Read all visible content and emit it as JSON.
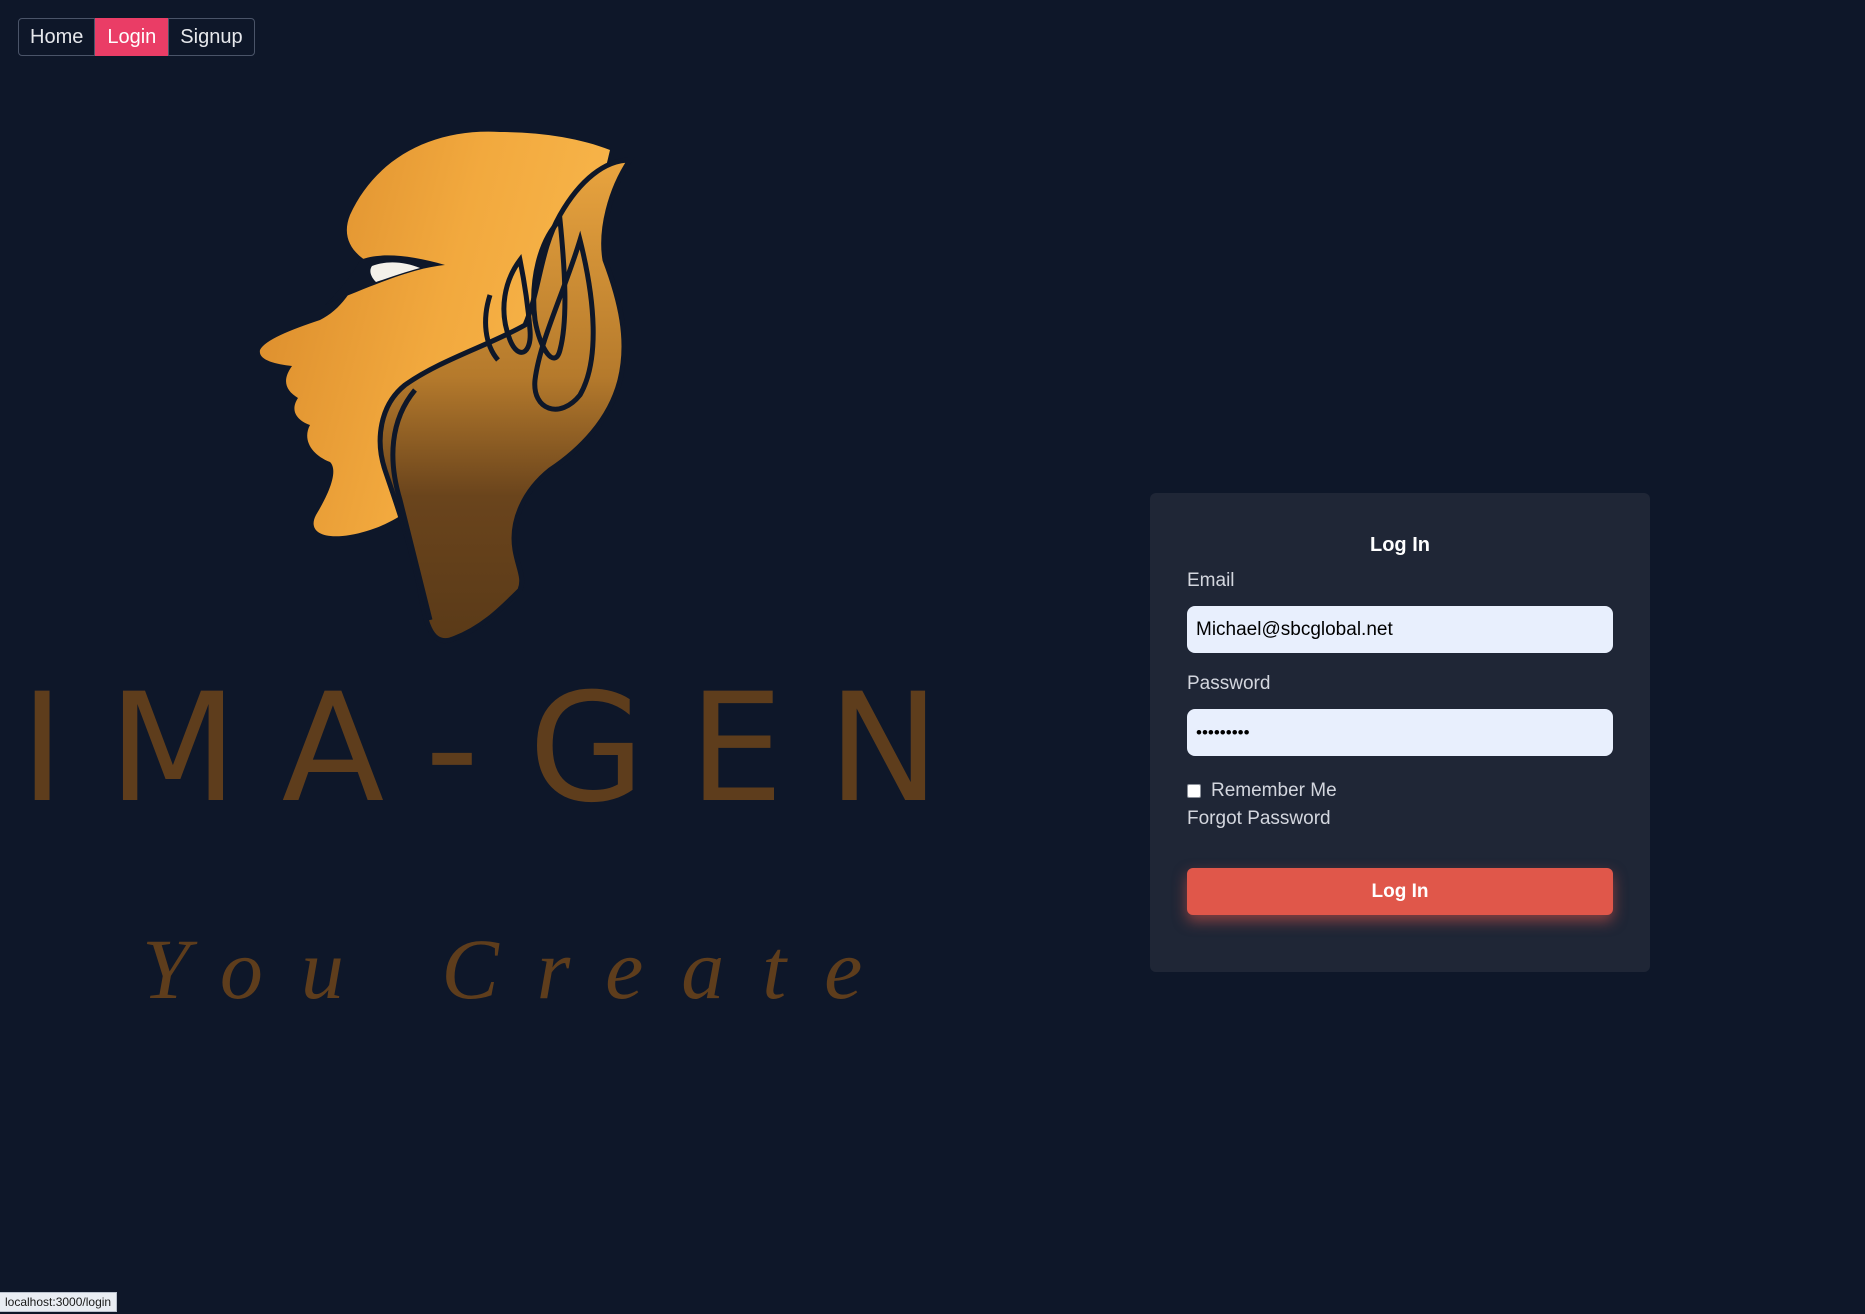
{
  "nav": {
    "items": [
      {
        "label": "Home",
        "active": false
      },
      {
        "label": "Login",
        "active": true
      },
      {
        "label": "Signup",
        "active": false
      }
    ]
  },
  "brand": {
    "name": "IMA-GEN",
    "tagline": "You Create",
    "logo_icon": "head-with-hand-icon",
    "colors": {
      "logo_light": "#f5b14a",
      "logo_dark": "#5a3a1a",
      "wordmark": "#5e3d1c"
    }
  },
  "login_form": {
    "title": "Log In",
    "email_label": "Email",
    "email_value": "Michael@sbcglobal.net",
    "password_label": "Password",
    "password_value": "•••••••••",
    "remember_label": "Remember Me",
    "remember_checked": false,
    "forgot_label": "Forgot Password",
    "submit_label": "Log In"
  },
  "status_bar": {
    "url": "localhost:3000/login"
  },
  "colors": {
    "background": "#0e1729",
    "card": "#1f2636",
    "accent": "#ea3d66",
    "submit": "#e0574a",
    "input_bg": "#e8effd"
  }
}
